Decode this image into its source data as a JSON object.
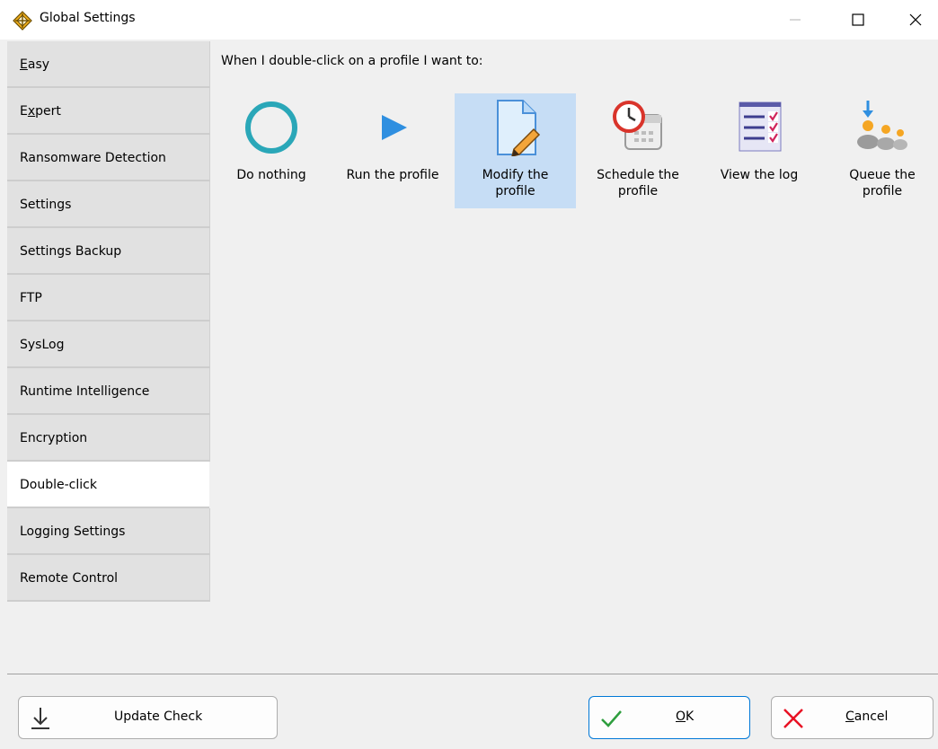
{
  "window": {
    "title": "Global Settings",
    "icon": "app-diamond-icon"
  },
  "sidebar": {
    "items": [
      {
        "label": "Easy",
        "accel": "E",
        "rest": "asy"
      },
      {
        "label": "Expert",
        "pre": "E",
        "accel": "x",
        "rest": "pert"
      },
      {
        "label": "Ransomware Detection"
      },
      {
        "label": "Settings"
      },
      {
        "label": "Settings Backup"
      },
      {
        "label": "FTP"
      },
      {
        "label": "SysLog"
      },
      {
        "label": "Runtime Intelligence"
      },
      {
        "label": "Encryption"
      },
      {
        "label": "Double-click",
        "active": true
      },
      {
        "label": "Logging Settings"
      },
      {
        "label": "Remote Control"
      }
    ]
  },
  "main": {
    "prompt": "When I double-click on a profile I want to:",
    "options": [
      {
        "label": "Do nothing",
        "icon": "circle-icon"
      },
      {
        "label": "Run the profile",
        "icon": "play-icon"
      },
      {
        "label": "Modify the\nprofile",
        "icon": "document-edit-icon",
        "selected": true
      },
      {
        "label": "Schedule the\nprofile",
        "icon": "calendar-clock-icon"
      },
      {
        "label": "View the log",
        "icon": "checklist-icon"
      },
      {
        "label": "Queue the\nprofile",
        "icon": "queue-people-icon"
      }
    ]
  },
  "footer": {
    "update_label": "Update Check",
    "ok_label": "OK",
    "cancel_label": "Cancel"
  },
  "colors": {
    "selected_bg": "#c6ddf5",
    "accent": "#0078d7",
    "ok_green": "#2e9e3e",
    "cancel_red": "#e81123"
  }
}
